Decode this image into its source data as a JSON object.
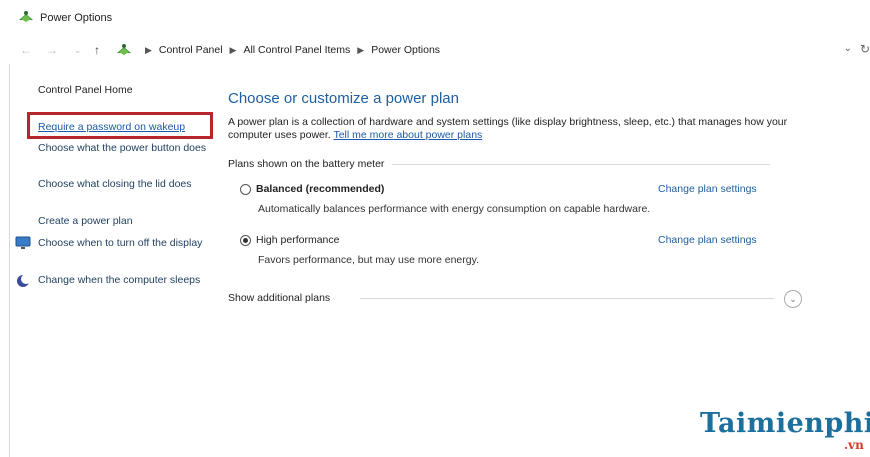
{
  "window": {
    "title": "Power Options",
    "icon": "power-options-icon"
  },
  "nav": {
    "back_icon": "back-arrow-icon",
    "forward_icon": "forward-arrow-icon",
    "recent_icon": "chevron-down-icon",
    "up_icon": "up-arrow-icon",
    "breadcrumbs": [
      "Control Panel",
      "All Control Panel Items",
      "Power Options"
    ],
    "refresh_icon": "refresh-icon"
  },
  "sidebar": {
    "home": "Control Panel Home",
    "links": [
      {
        "label": "Require a password on wakeup",
        "icon": ""
      },
      {
        "label": "Choose what the power button does",
        "icon": ""
      },
      {
        "label": "Choose what closing the lid does",
        "icon": ""
      },
      {
        "label": "Create a power plan",
        "icon": ""
      },
      {
        "label": "Choose when to turn off the display",
        "icon": "monitor-icon"
      },
      {
        "label": "Change when the computer sleeps",
        "icon": "moon-icon"
      }
    ],
    "highlight_color": "#b6262b"
  },
  "main": {
    "title": "Choose or customize a power plan",
    "intro": "A power plan is a collection of hardware and system settings (like display brightness, sleep, etc.) that manages how your computer uses power.",
    "learn_more": "Tell me more about power plans",
    "section_label": "Plans shown on the battery meter",
    "plans": [
      {
        "name": "Balanced (recommended)",
        "description": "Automatically balances performance with energy consumption on capable hardware.",
        "settings_link": "Change plan settings",
        "selected": false
      },
      {
        "name": "High performance",
        "description": "Favors performance, but may use more energy.",
        "settings_link": "Change plan settings",
        "selected": true
      }
    ],
    "additional_plans": "Show additional plans",
    "expand_icon": "chevron-down-circle-icon"
  },
  "watermark": {
    "main": "Taimienphi",
    "sub": ".vn"
  },
  "colors": {
    "link": "#1e5fa0",
    "title": "#1e5fa0",
    "watermark_blue": "#1d6f9e",
    "watermark_red": "#d23a2a"
  }
}
